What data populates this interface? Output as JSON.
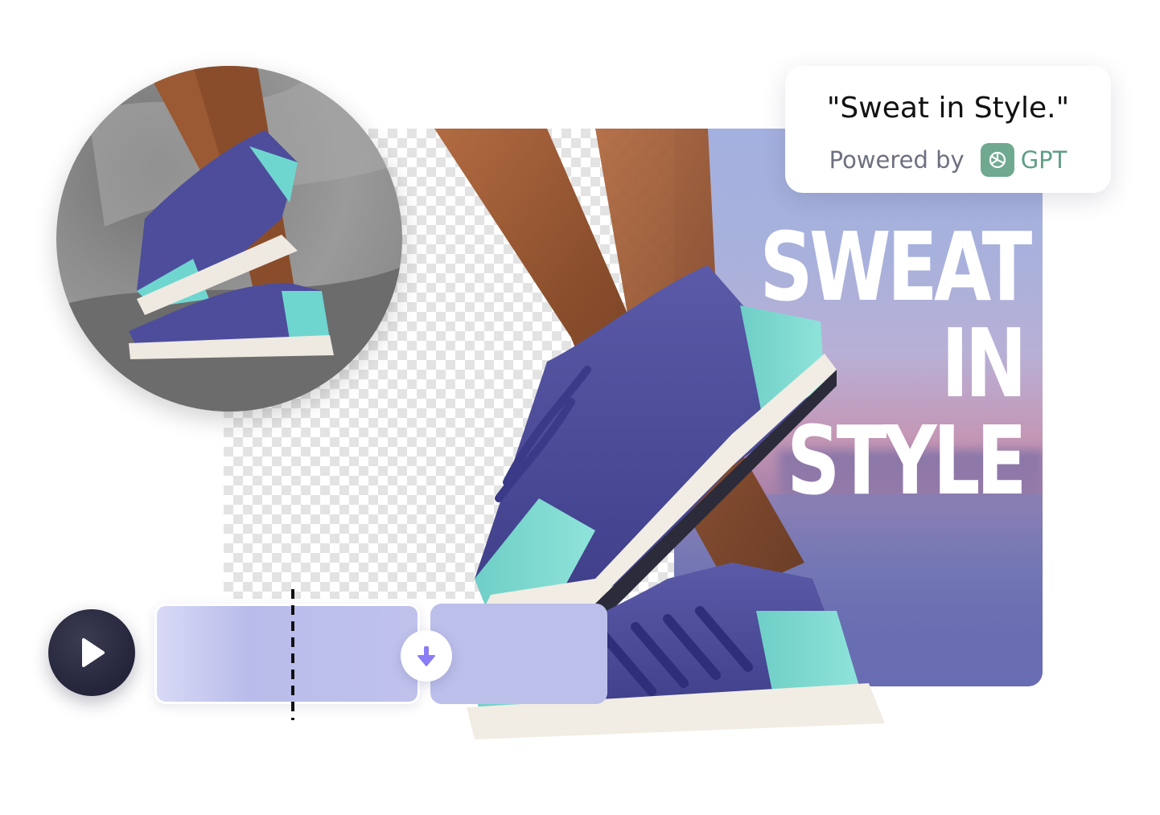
{
  "caption": {
    "quote": "\"Sweat in Style.\"",
    "powered_by": "Powered by",
    "provider": "GPT"
  },
  "poster": {
    "headline": [
      "SWEAT",
      "IN",
      "STYLE"
    ]
  },
  "icons": {
    "play": "play-icon",
    "split": "arrow-down-icon",
    "provider_logo": "openai-logo-icon"
  },
  "colors": {
    "accent": "#8b7cf6",
    "play_button": "#2a2a40",
    "clip": "#bcbfea",
    "gpt_green": "#5f9f86",
    "shoe_upper": "#4b4b9a",
    "shoe_accent": "#6fd6cf",
    "shoe_sole": "#f1ede4"
  }
}
